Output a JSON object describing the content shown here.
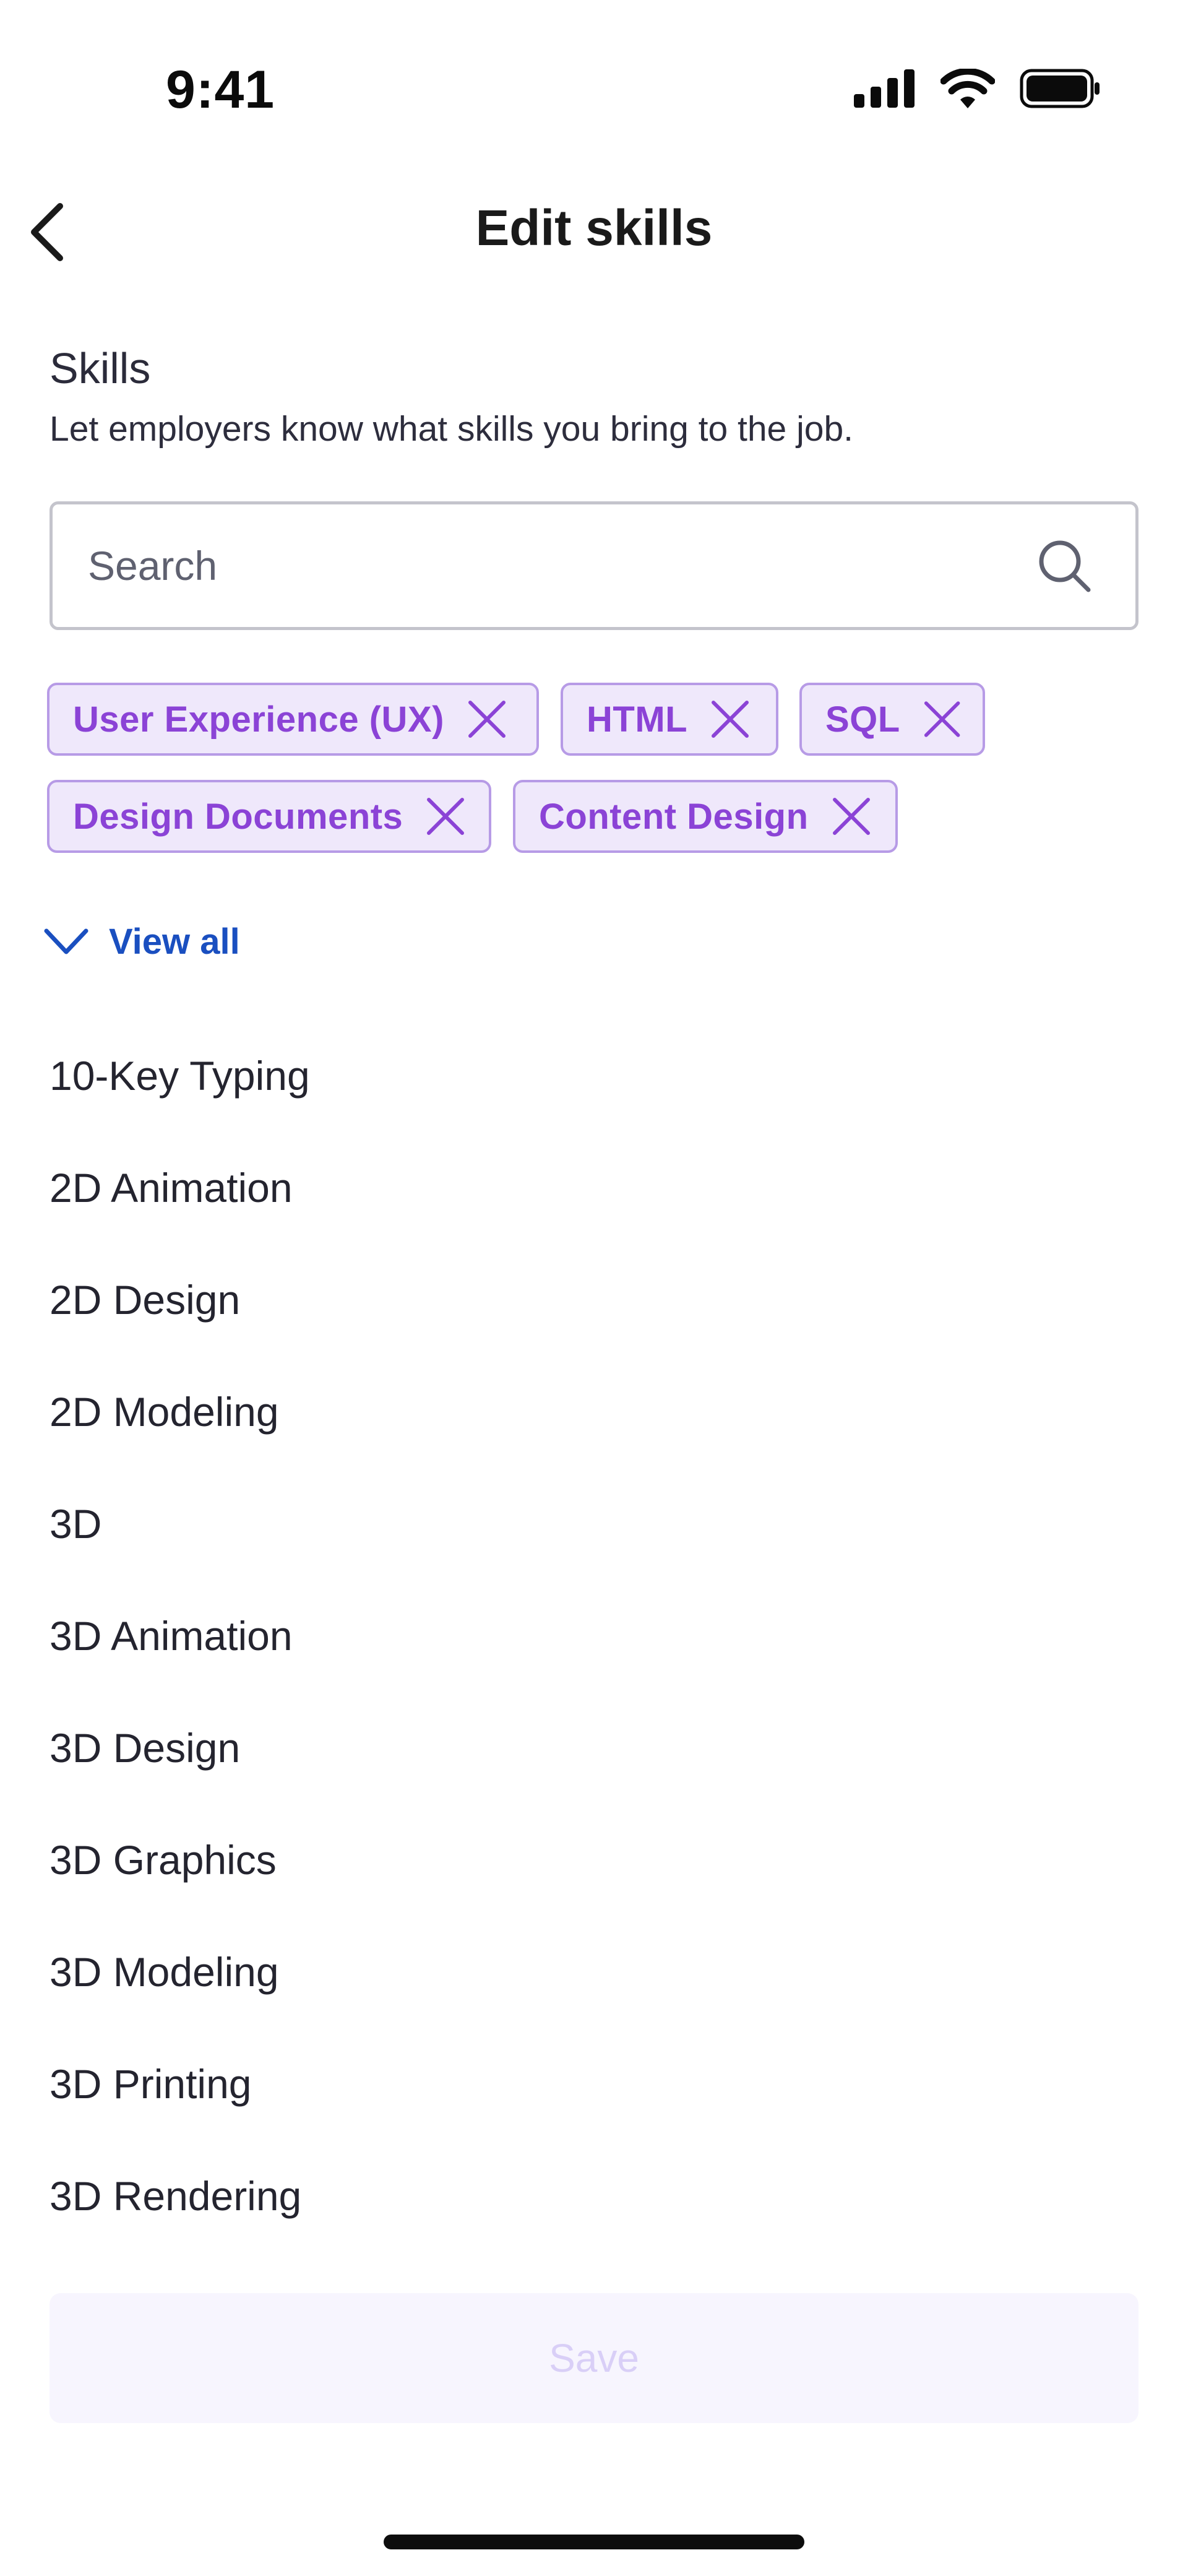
{
  "status_bar": {
    "time": "9:41",
    "icons": [
      "cellular-signal-icon",
      "wifi-icon",
      "battery-icon"
    ]
  },
  "header": {
    "title": "Edit skills",
    "back_icon": "chevron-left-icon"
  },
  "section": {
    "title": "Skills",
    "subtitle": "Let employers know what skills you bring to the job."
  },
  "search": {
    "placeholder": "Search",
    "value": "",
    "icon": "search-icon"
  },
  "selected_skills": [
    {
      "label": "User Experience (UX)"
    },
    {
      "label": "HTML"
    },
    {
      "label": "SQL"
    },
    {
      "label": "Design Documents"
    },
    {
      "label": "Content Design"
    }
  ],
  "view_all": {
    "label": "View all",
    "icon": "chevron-down-icon"
  },
  "skill_list": [
    "10-Key Typing",
    "2D Animation",
    "2D Design",
    "2D Modeling",
    "3D",
    "3D Animation",
    "3D Design",
    "3D Graphics",
    "3D Modeling",
    "3D Printing",
    "3D Rendering"
  ],
  "save": {
    "label": "Save",
    "enabled": false
  },
  "colors": {
    "chip_text": "#8b43d6",
    "chip_bg": "#efe8fb",
    "chip_border": "#b79be6",
    "link": "#1a4fc0",
    "save_disabled_bg": "#f7f5fe",
    "save_disabled_text": "#d9cff7"
  }
}
